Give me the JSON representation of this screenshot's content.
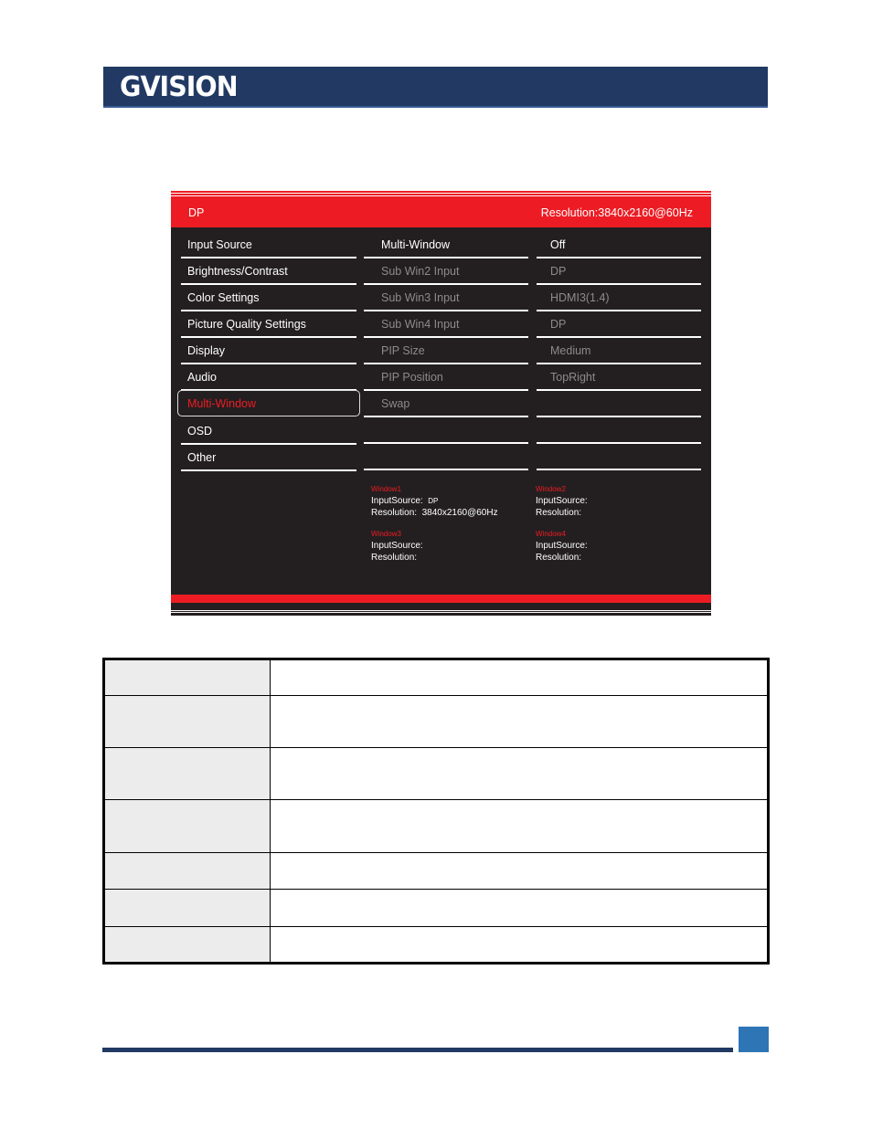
{
  "header": {
    "logo_text": "GVISION",
    "banner_color": "#213963"
  },
  "osd": {
    "top_bar": {
      "input_source": "DP",
      "resolution": "Resolution:3840x2160@60Hz"
    },
    "main_menu": [
      {
        "label": "Input Source",
        "selected": false
      },
      {
        "label": "Brightness/Contrast",
        "selected": false
      },
      {
        "label": "Color Settings",
        "selected": false
      },
      {
        "label": "Picture Quality Settings",
        "selected": false
      },
      {
        "label": "Display",
        "selected": false
      },
      {
        "label": "Audio",
        "selected": false
      },
      {
        "label": "Multi-Window",
        "selected": true
      },
      {
        "label": "OSD",
        "selected": false
      },
      {
        "label": "Other",
        "selected": false
      }
    ],
    "sub_menu": [
      {
        "label": "Multi-Window",
        "value": "Off",
        "enabled": true
      },
      {
        "label": "Sub Win2 Input",
        "value": "DP",
        "enabled": false
      },
      {
        "label": "Sub Win3 Input",
        "value": "HDMI3(1.4)",
        "enabled": false
      },
      {
        "label": "Sub Win4 Input",
        "value": "DP",
        "enabled": false
      },
      {
        "label": "PIP Size",
        "value": "Medium",
        "enabled": false
      },
      {
        "label": "PIP Position",
        "value": "TopRight",
        "enabled": false
      },
      {
        "label": "Swap",
        "value": "",
        "enabled": false
      },
      {
        "label": "",
        "value": "",
        "enabled": false
      },
      {
        "label": "",
        "value": "",
        "enabled": false
      }
    ],
    "windows": [
      {
        "title": "Window1",
        "input_label": "InputSource:",
        "input_value": "DP",
        "resolution_label": "Resolution:",
        "resolution_value": "3840x2160@60Hz"
      },
      {
        "title": "Window2",
        "input_label": "InputSource:",
        "input_value": "",
        "resolution_label": "Resolution:",
        "resolution_value": ""
      },
      {
        "title": "Window3",
        "input_label": "InputSource:",
        "input_value": "",
        "resolution_label": "Resolution:",
        "resolution_value": ""
      },
      {
        "title": "Window4",
        "input_label": "InputSource:",
        "input_value": "",
        "resolution_label": "Resolution:",
        "resolution_value": ""
      }
    ],
    "colors": {
      "accent": "#ed1c24",
      "background": "#231f20",
      "disabled_text": "#8c8a8b"
    }
  },
  "table": {
    "rows": [
      {
        "key": "",
        "value": ""
      },
      {
        "key": "",
        "value": ""
      },
      {
        "key": "",
        "value": ""
      },
      {
        "key": "",
        "value": ""
      },
      {
        "key": "",
        "value": ""
      },
      {
        "key": "",
        "value": ""
      },
      {
        "key": "",
        "value": ""
      }
    ]
  },
  "footer": {
    "line_color": "#213963",
    "page_box_color": "#2e75b6"
  }
}
